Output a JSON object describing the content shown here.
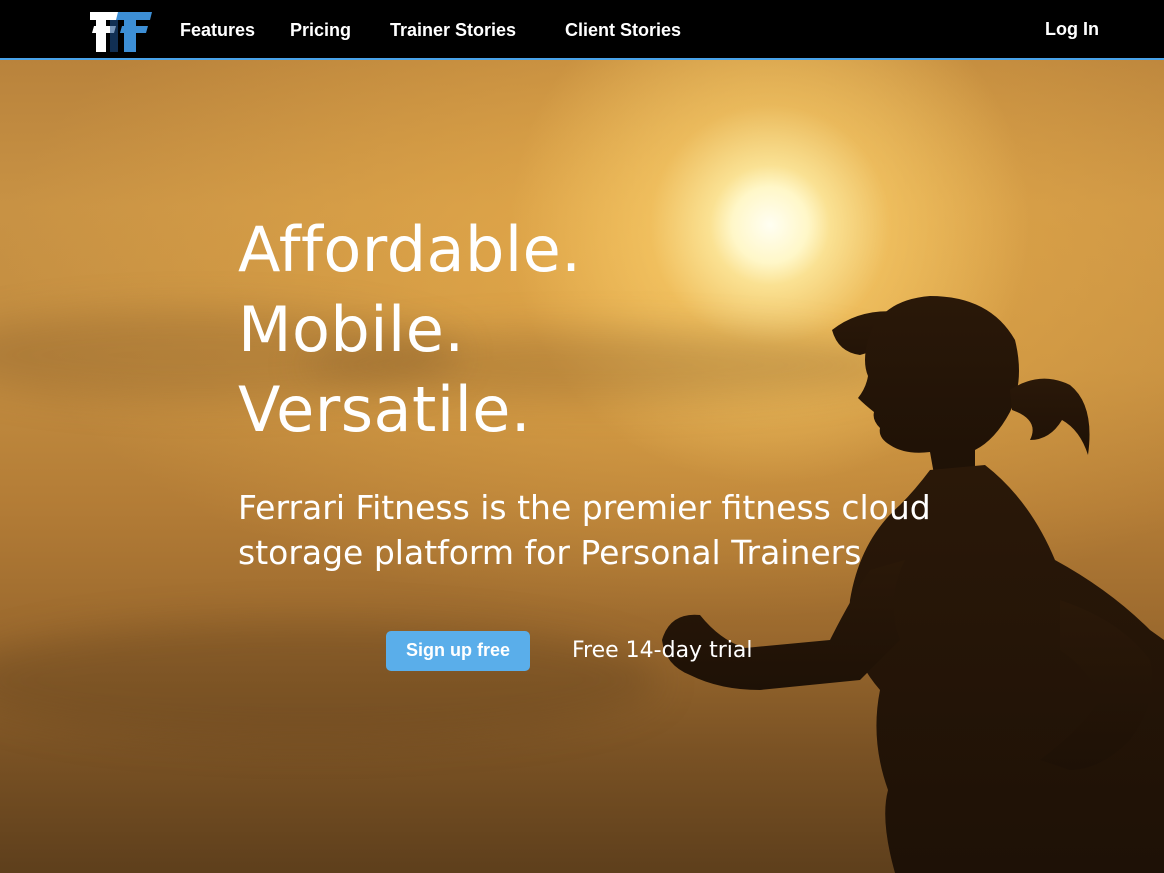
{
  "brand": {
    "logo_text": "FF"
  },
  "nav": {
    "items": [
      "Features",
      "Pricing",
      "Trainer Stories",
      "Client Stories"
    ],
    "login": "Log In"
  },
  "hero": {
    "headline": [
      "Affordable.",
      "Mobile.",
      "Versatile."
    ],
    "tagline": "Ferrari Fitness is the premier fitness cloud storage platform for Personal Trainers",
    "cta": "Sign up free",
    "trial": "Free 14-day trial"
  },
  "colors": {
    "nav_bg": "#000000",
    "accent": "#4aa3e8",
    "cta_bg": "#5aaeea",
    "text": "#ffffff"
  }
}
